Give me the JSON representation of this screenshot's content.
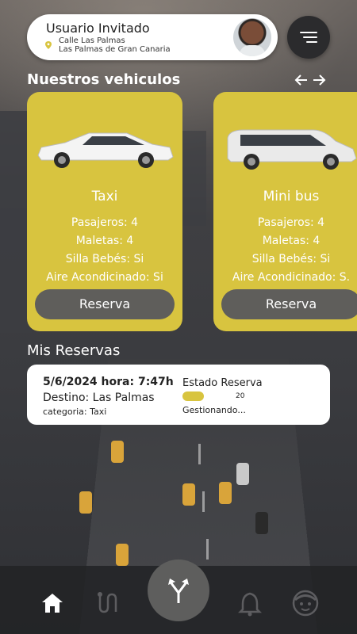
{
  "user": {
    "name": "Usuario Invitado",
    "address_line1": "Calle Las Palmas",
    "address_line2": "Las Palmas de Gran Canaria"
  },
  "vehicles_section": {
    "title": "Nuestros  vehiculos"
  },
  "vehicles": [
    {
      "name": "Taxi",
      "pasajeros": "Pasajeros: 4",
      "maletas": "Maletas: 4",
      "silla": "Silla Bebés: Si",
      "aire": "Aire Acondicinado: Si",
      "button": "Reserva"
    },
    {
      "name": "Mini bus",
      "pasajeros": "Pasajeros: 4",
      "maletas": "Maletas: 4",
      "silla": "Silla Bebés: Si",
      "aire": "Aire Acondicinado: S.",
      "button": "Reserva"
    }
  ],
  "reservations": {
    "title": "Mis Reservas",
    "items": [
      {
        "date": "5/6/2024  hora: 7:47h",
        "destino": "Destino: Las Palmas",
        "categoria": "categoria: Taxi",
        "estado_label": "Estado Reserva",
        "progress_value": "20",
        "progress_fraction": 0.2,
        "status": "Gestionando..."
      }
    ]
  },
  "nav": {
    "items": [
      "home-icon",
      "route-icon",
      "fork-arrow-icon",
      "bell-icon",
      "face-icon"
    ],
    "active": "home-icon"
  },
  "colors": {
    "accent_yellow": "#d8c43f",
    "button_gray": "#5f5e5b",
    "dark": "#2b2b2d"
  }
}
